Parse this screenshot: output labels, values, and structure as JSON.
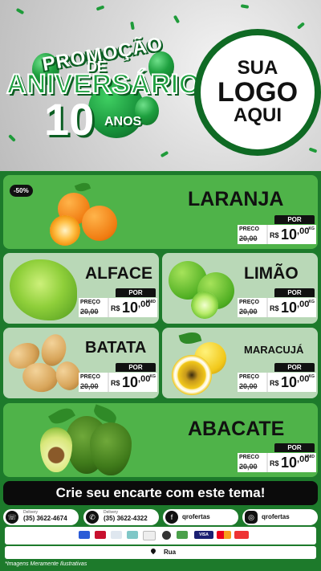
{
  "header": {
    "promo_line1": "PROMOÇÃO",
    "promo_line2": "DE",
    "promo_line3": "ANIVERSÁRIO",
    "promo_number": "10",
    "promo_line4": "ANOS",
    "logo_line1": "SUA",
    "logo_line2": "LOGO",
    "logo_line3": "AQUI"
  },
  "products": [
    {
      "name": "LARANJA",
      "badge": "-50%",
      "preco_label": "PRECO",
      "old_price": "20,00",
      "currency": "R$",
      "price_int": "10",
      "price_cents": ",00",
      "unit": "KG",
      "por": "POR"
    },
    {
      "name": "ALFACE",
      "preco_label": "PREÇO",
      "old_price": "20,00",
      "currency": "R$",
      "price_int": "10",
      "price_cents": ",00",
      "unit": "UNID",
      "por": "POR"
    },
    {
      "name": "LIMÃO",
      "preco_label": "PREÇO",
      "old_price": "20,00",
      "currency": "R$",
      "price_int": "10",
      "price_cents": ",00",
      "unit": "KG",
      "por": "POR"
    },
    {
      "name": "BATATA",
      "preco_label": "PREÇO",
      "old_price": "20,00",
      "currency": "R$",
      "price_int": "10",
      "price_cents": ",00",
      "unit": "KG",
      "por": "POR"
    },
    {
      "name": "MARACUJÁ",
      "preco_label": "PREÇO",
      "old_price": "20,00",
      "currency": "R$",
      "price_int": "10",
      "price_cents": ",00",
      "unit": "KG",
      "por": "POR"
    },
    {
      "name": "ABACATE",
      "preco_label": "PRECO",
      "old_price": "20,00",
      "currency": "R$",
      "price_int": "10",
      "price_cents": ",00",
      "unit": "UNID",
      "por": "POR"
    }
  ],
  "cta": "Crie seu encarte com este tema!",
  "contacts": [
    {
      "icon": "whatsapp-icon",
      "label": "Delivery",
      "value": "(35) 3622-4674"
    },
    {
      "icon": "phone-icon",
      "label": "Delivery",
      "value": "(35) 3622-4322"
    },
    {
      "icon": "facebook-icon",
      "value": "qrofertas"
    },
    {
      "icon": "instagram-icon",
      "value": "qrofertas"
    }
  ],
  "address": "Rua",
  "disclaimer": "*Imagens Meramente Ilustrativas",
  "colors": {
    "brand_green": "#1d7a2b",
    "card_green": "#4fb349",
    "card_pale": "#b9d8b7"
  }
}
